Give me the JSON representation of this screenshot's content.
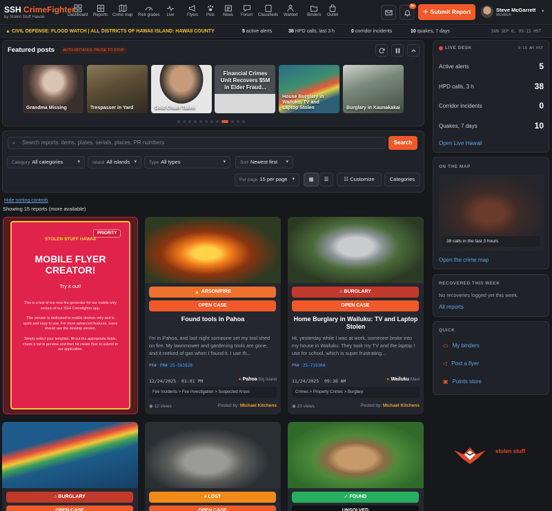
{
  "brand": {
    "name": "SSH",
    "name_accent": "CrimeFighter",
    "tagline": "by Stolen Stuff Hawaii"
  },
  "nav": [
    {
      "label": "Dashboard",
      "icon": "grid-icon"
    },
    {
      "label": "Reports",
      "icon": "grid-small-icon"
    },
    {
      "label": "Crime map",
      "icon": "map-icon"
    },
    {
      "label": "Risk grades",
      "icon": "gauge-icon"
    },
    {
      "label": "Live",
      "icon": "pulse-icon"
    },
    {
      "label": "Flyers",
      "icon": "megaphone-icon"
    },
    {
      "label": "Pets",
      "icon": "paw-icon"
    },
    {
      "label": "News",
      "icon": "newspaper-icon"
    },
    {
      "label": "Forum",
      "icon": "chat-icon"
    },
    {
      "label": "Classifieds",
      "icon": "store-icon"
    },
    {
      "label": "Wanted",
      "icon": "person-icon"
    },
    {
      "label": "Binders",
      "icon": "folder-icon"
    },
    {
      "label": "Outlet",
      "icon": "shop-icon"
    }
  ],
  "header": {
    "notif_count": "9+",
    "submit_label": "Submit Report",
    "user_name": "Steve McGarrett",
    "user_role": "MEMBER"
  },
  "ticker": {
    "alert": "CIVIL DEFENSE: FLOOD WATCH | ALL DISTRICTS OF HAWAII ISLAND: HAWAII COUNTY",
    "alerts_num": "5",
    "alerts_txt": "active alerts",
    "hpd_num": "38",
    "hpd_txt": "HPD calls, last 3 h",
    "corr_num": "0",
    "corr_txt": "corridor incidents",
    "quake_num": "10",
    "quake_txt": "quakes, 7 days",
    "datetime": "SUN SEP 6, 09:15 HST"
  },
  "featured": {
    "title": "Featured posts",
    "hint": "AUTO-ROTATES, PAUSE TO STOP",
    "items": [
      "Grandma Missing",
      "Trespasser in Yard",
      "Gold Chain Taken",
      "Financial Crimes Unit Recovers $5M in Elder Fraud...",
      "House Burglary in Wailuku, TV and Laptop Stolen",
      "Burglary in Kaunakakai"
    ]
  },
  "filters": {
    "search_placeholder": "Search reports: items, plates, serials, places, PR numbers",
    "search_button": "Search",
    "category_label": "Category",
    "category_value": "All categories",
    "island_label": "Island",
    "island_value": "All islands",
    "type_label": "Type",
    "type_value": "All types",
    "sort_label": "Sort",
    "sort_value": "Newest first",
    "perpage_label": "Per page",
    "perpage_value": "15 per page",
    "customize": "Customize",
    "categories": "Categories",
    "hide_sorting": "Hide sorting controls",
    "showing": "Showing 15 reports (more available)"
  },
  "promo": {
    "brand": "STOLEN STUFF HAWAII",
    "priority": "PRIORITY",
    "title": "MOBILE FLYER CREATOR!",
    "sub": "Try it out!",
    "p1": "This is a test of our new fire generator for our mobile only version of our SSH Crimefighter app.",
    "p2": "This version is dedicated to mobile devices only and is quick and easy to use. For more advanced features, users should use the desktop version.",
    "p3": "Simply select your template, fill out the appropriate fields, check it out in preview and then hit create flyer to submit to our application."
  },
  "cards": [
    {
      "category": "ARSON/FIRE",
      "status": "OPEN CASE",
      "title": "Found tools in Pahoa",
      "desc": "I'm in Pahoa, and last night someone set my tool shed on fire. My lawnmower and gardening tools are gone, and it reeked of gas when I found it. I use th...",
      "pr_label": "PR#",
      "pr": "PR# 25-563920",
      "date": "12/24/2025",
      "time": "01:01 PM",
      "town": "Pahoa",
      "island": "Big Island",
      "crumb": "Fire Incidents > Fire Investigation > Suspected Arson",
      "views": "12 views",
      "posted": "Posted by:",
      "author": "Michael Kitchens",
      "accent": "#f0592a"
    },
    {
      "category": "BURGLARY",
      "status": "OPEN CASE",
      "title": "Home Burglary in Wailuku: TV and Laptop Stolen",
      "desc": "Hi, yesterday while I was at work, someone broke into my house in Wailuku. They took my TV and the laptop I use for school, which is super frustrating...",
      "pr_label": "PR#",
      "pr": "25-719304",
      "date": "11/24/2025",
      "time": "09:38 AM",
      "town": "Wailuku",
      "island": "Maui",
      "crumb": "Crimes > Property Crimes > Burglary",
      "views": "23 views",
      "posted": "Posted by:",
      "author": "Michael Kitchens",
      "accent": "#c0392b"
    }
  ],
  "row2": [
    {
      "category": "BURGLARY",
      "status": "OPEN CASE"
    },
    {
      "category": "LOST",
      "status": "OPEN CASE"
    },
    {
      "category": "FOUND",
      "status": "UNSOLVED"
    }
  ],
  "live": {
    "title": "LIVE DESK",
    "time": "9:15 AM HST",
    "rows": [
      {
        "label": "Active alerts",
        "value": "5"
      },
      {
        "label": "HPD calls, 3 h",
        "value": "38"
      },
      {
        "label": "Corridor incidents",
        "value": "0"
      },
      {
        "label": "Quakes, 7 days",
        "value": "10"
      }
    ],
    "link": "Open Live Hawaii"
  },
  "map": {
    "title": "ON THE MAP",
    "caption": "38 calls in the last 3 hours",
    "link": "Open the crime map"
  },
  "recovered": {
    "title": "RECOVERED THIS WEEK",
    "text": "No recoveries logged yet this week.",
    "link": "All reports"
  },
  "quick": {
    "title": "QUICK",
    "items": [
      "My binders",
      "Post a flyer",
      "Points store"
    ]
  },
  "logo": {
    "text": "stolen stuff"
  }
}
